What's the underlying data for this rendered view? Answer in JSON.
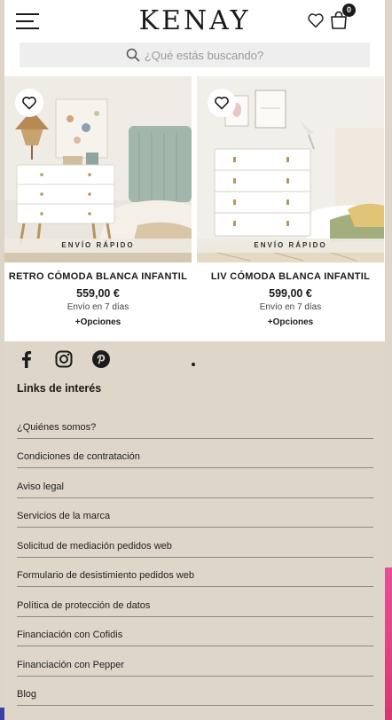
{
  "header": {
    "logo": "KENAY",
    "cart_count": "0",
    "search_placeholder": "¿Qué estás buscando?"
  },
  "products": [
    {
      "name": "RETRO CÓMODA BLANCA INFANTIL",
      "price": "559,00 €",
      "shipping": "Envío en 7 días",
      "options": "+Opciones",
      "badge": "ENVÍO RÁPIDO"
    },
    {
      "name": "LIV CÓMODA BLANCA INFANTIL",
      "price": "599,00 €",
      "shipping": "Envío en 7 días",
      "options": "+Opciones",
      "badge": "ENVÍO RÁPIDO"
    }
  ],
  "footer": {
    "socials": [
      "facebook-icon",
      "instagram-icon",
      "pinterest-icon"
    ],
    "links_title": "Links de interés",
    "links": [
      "¿Quiénes somos?",
      "Condiciones de contratación",
      "Aviso legal",
      "Servicios de la marca",
      "Solicitud de mediación pedidos web",
      "Formulario de desistimiento pedidos web",
      "Política de protección de datos",
      "Financiación con Cofidis",
      "Financiación con Pepper",
      "Blog"
    ]
  },
  "colors": {
    "footer_bg": "#ddd6c9",
    "accent": "#d6386f"
  }
}
